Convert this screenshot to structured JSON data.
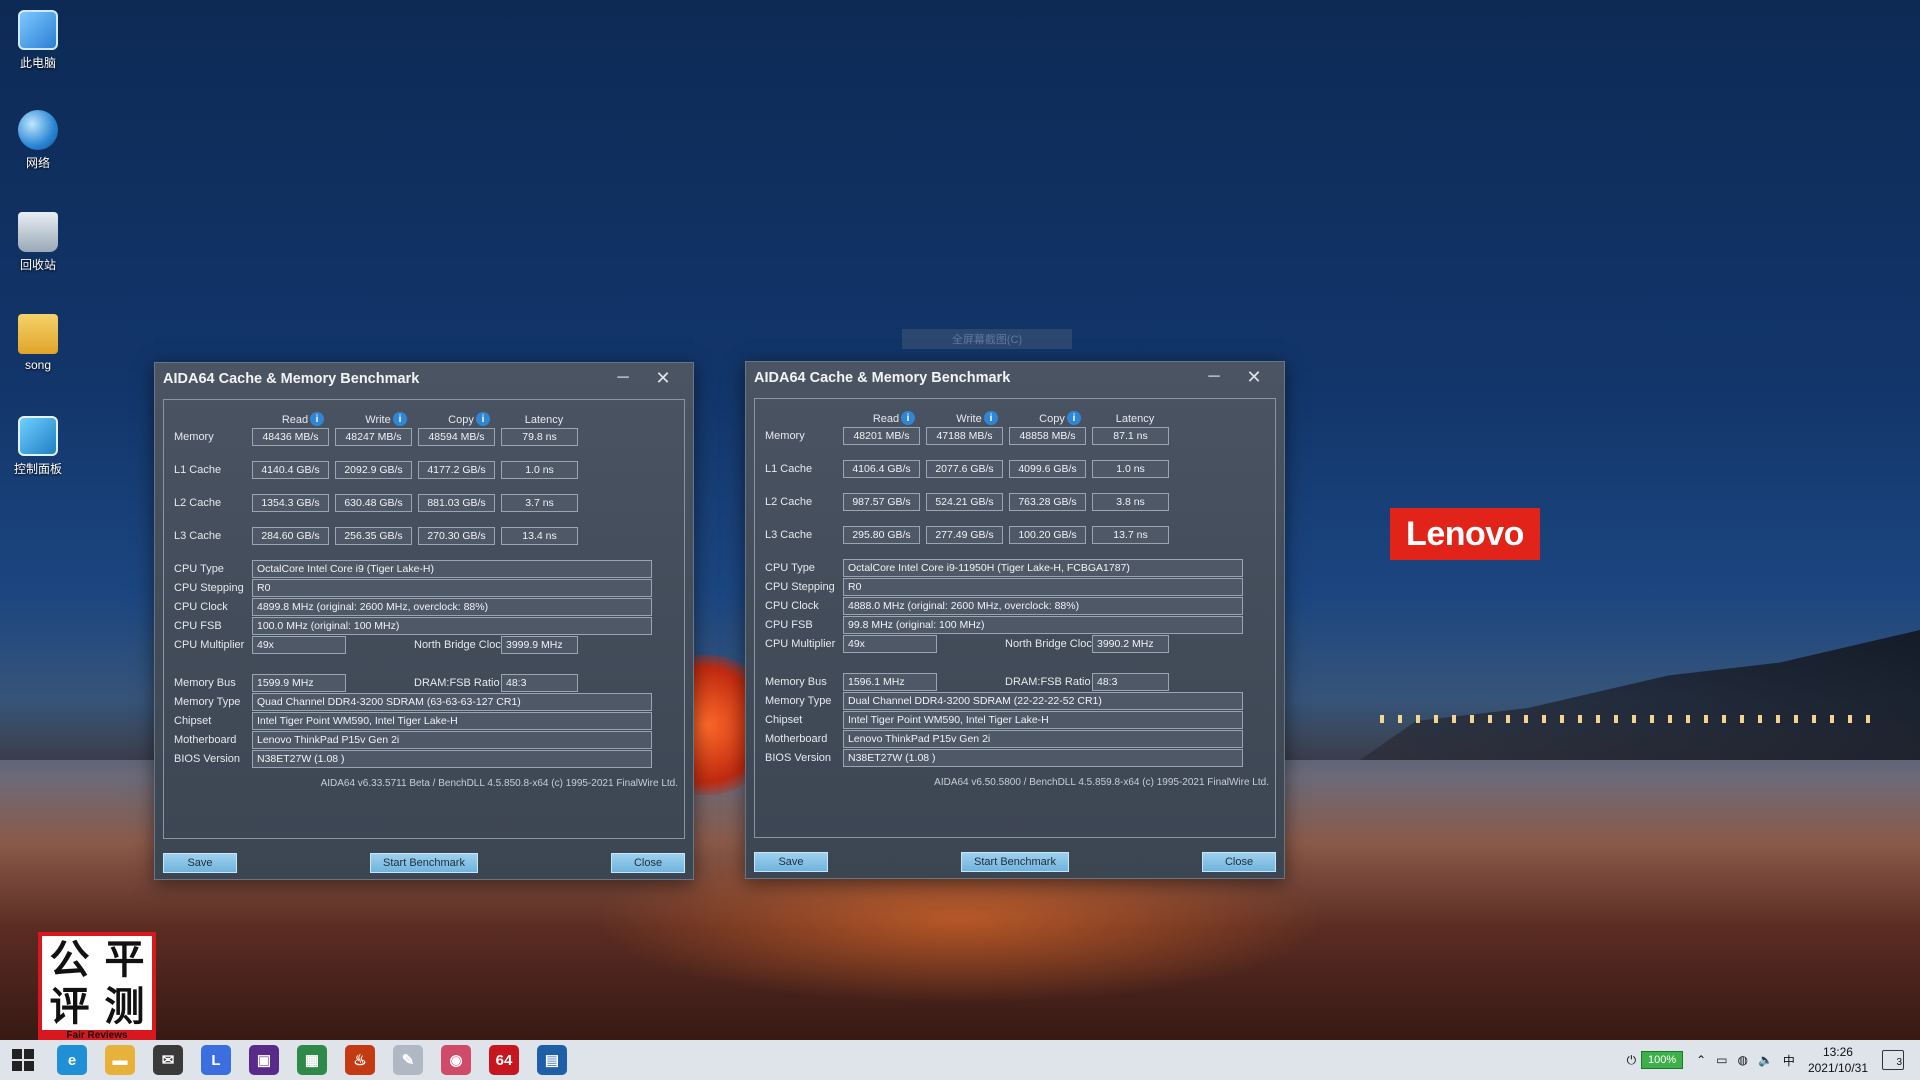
{
  "desktop": {
    "icons": [
      {
        "label": "此电脑"
      },
      {
        "label": "网络"
      },
      {
        "label": "回收站"
      },
      {
        "label": "song"
      },
      {
        "label": "控制面板"
      }
    ],
    "brand": "Lenovo",
    "faded_bar": "全屏幕截图(C)"
  },
  "windows": [
    {
      "title": "AIDA64 Cache & Memory Benchmark",
      "columns": [
        "Read",
        "Write",
        "Copy",
        "Latency"
      ],
      "rows": [
        {
          "label": "Memory",
          "values": [
            "48436 MB/s",
            "48247 MB/s",
            "48594 MB/s",
            "79.8 ns"
          ]
        },
        {
          "label": "L1 Cache",
          "values": [
            "4140.4 GB/s",
            "2092.9 GB/s",
            "4177.2 GB/s",
            "1.0 ns"
          ]
        },
        {
          "label": "L2 Cache",
          "values": [
            "1354.3 GB/s",
            "630.48 GB/s",
            "881.03 GB/s",
            "3.7 ns"
          ]
        },
        {
          "label": "L3 Cache",
          "values": [
            "284.60 GB/s",
            "256.35 GB/s",
            "270.30 GB/s",
            "13.4 ns"
          ]
        }
      ],
      "cpu_type": {
        "label": "CPU Type",
        "value": "OctalCore Intel Core i9  (Tiger Lake-H)"
      },
      "cpu_stepping": {
        "label": "CPU Stepping",
        "value": "R0"
      },
      "cpu_clock": {
        "label": "CPU Clock",
        "value": "4899.8 MHz  (original: 2600 MHz, overclock: 88%)"
      },
      "cpu_fsb": {
        "label": "CPU FSB",
        "value": "100.0 MHz  (original: 100 MHz)"
      },
      "cpu_multiplier": {
        "label": "CPU Multiplier",
        "value": "49x"
      },
      "nb_clock": {
        "label": "North Bridge Clock",
        "value": "3999.9 MHz"
      },
      "memory_bus": {
        "label": "Memory Bus",
        "value": "1599.9 MHz"
      },
      "dram_ratio": {
        "label": "DRAM:FSB Ratio",
        "value": "48:3"
      },
      "memory_type": {
        "label": "Memory Type",
        "value": "Quad Channel DDR4-3200 SDRAM  (63-63-63-127 CR1)"
      },
      "chipset": {
        "label": "Chipset",
        "value": "Intel Tiger Point WM590, Intel Tiger Lake-H"
      },
      "motherboard": {
        "label": "Motherboard",
        "value": "Lenovo ThinkPad P15v Gen 2i"
      },
      "bios": {
        "label": "BIOS Version",
        "value": "N38ET27W (1.08 )"
      },
      "footer": "AIDA64 v6.33.5711 Beta / BenchDLL 4.5.850.8-x64  (c) 1995-2021 FinalWire Ltd.",
      "buttons": {
        "save": "Save",
        "start": "Start Benchmark",
        "close": "Close"
      }
    },
    {
      "title": "AIDA64 Cache & Memory Benchmark",
      "columns": [
        "Read",
        "Write",
        "Copy",
        "Latency"
      ],
      "rows": [
        {
          "label": "Memory",
          "values": [
            "48201 MB/s",
            "47188 MB/s",
            "48858 MB/s",
            "87.1 ns"
          ]
        },
        {
          "label": "L1 Cache",
          "values": [
            "4106.4 GB/s",
            "2077.6 GB/s",
            "4099.6 GB/s",
            "1.0 ns"
          ]
        },
        {
          "label": "L2 Cache",
          "values": [
            "987.57 GB/s",
            "524.21 GB/s",
            "763.28 GB/s",
            "3.8 ns"
          ]
        },
        {
          "label": "L3 Cache",
          "values": [
            "295.80 GB/s",
            "277.49 GB/s",
            "100.20 GB/s",
            "13.7 ns"
          ]
        }
      ],
      "cpu_type": {
        "label": "CPU Type",
        "value": "OctalCore Intel Core i9-11950H  (Tiger Lake-H, FCBGA1787)"
      },
      "cpu_stepping": {
        "label": "CPU Stepping",
        "value": "R0"
      },
      "cpu_clock": {
        "label": "CPU Clock",
        "value": "4888.0 MHz  (original: 2600 MHz, overclock: 88%)"
      },
      "cpu_fsb": {
        "label": "CPU FSB",
        "value": "99.8 MHz  (original: 100 MHz)"
      },
      "cpu_multiplier": {
        "label": "CPU Multiplier",
        "value": "49x"
      },
      "nb_clock": {
        "label": "North Bridge Clock",
        "value": "3990.2 MHz"
      },
      "memory_bus": {
        "label": "Memory Bus",
        "value": "1596.1 MHz"
      },
      "dram_ratio": {
        "label": "DRAM:FSB Ratio",
        "value": "48:3"
      },
      "memory_type": {
        "label": "Memory Type",
        "value": "Dual Channel DDR4-3200 SDRAM  (22-22-22-52 CR1)"
      },
      "chipset": {
        "label": "Chipset",
        "value": "Intel Tiger Point WM590, Intel Tiger Lake-H"
      },
      "motherboard": {
        "label": "Motherboard",
        "value": "Lenovo ThinkPad P15v Gen 2i"
      },
      "bios": {
        "label": "BIOS Version",
        "value": "N38ET27W (1.08 )"
      },
      "footer": "AIDA64 v6.50.5800 / BenchDLL 4.5.859.8-x64  (c) 1995-2021 FinalWire Ltd.",
      "buttons": {
        "save": "Save",
        "start": "Start Benchmark",
        "close": "Close"
      }
    }
  ],
  "watermark": {
    "chars": [
      "公",
      "平",
      "评",
      "测"
    ],
    "sub": "Fair Reviews"
  },
  "taskbar": {
    "apps": [
      {
        "name": "edge-icon",
        "color": "#1f8fd6",
        "glyph": "e"
      },
      {
        "name": "file-explorer-icon",
        "color": "#e8b23a",
        "glyph": "▬"
      },
      {
        "name": "mail-icon",
        "color": "#3a3a3a",
        "glyph": "✉"
      },
      {
        "name": "app-l-icon",
        "color": "#3b6fe0",
        "glyph": "L"
      },
      {
        "name": "cpu-z-icon",
        "color": "#5a2a8a",
        "glyph": "▣"
      },
      {
        "name": "gpu-icon",
        "color": "#2f8a4a",
        "glyph": "▦"
      },
      {
        "name": "furmark-icon",
        "color": "#c43a12",
        "glyph": "♨"
      },
      {
        "name": "feather-icon",
        "color": "#b0b8c4",
        "glyph": "✎"
      },
      {
        "name": "monitor-icon",
        "color": "#d04a6a",
        "glyph": "◉"
      },
      {
        "name": "aida64-icon",
        "color": "#c8161e",
        "glyph": "64"
      },
      {
        "name": "calculator-icon",
        "color": "#1f5fa8",
        "glyph": "▤"
      }
    ],
    "battery": "100%",
    "ime": "中",
    "time": "13:26",
    "date": "2021/10/31",
    "notifications": "3"
  }
}
